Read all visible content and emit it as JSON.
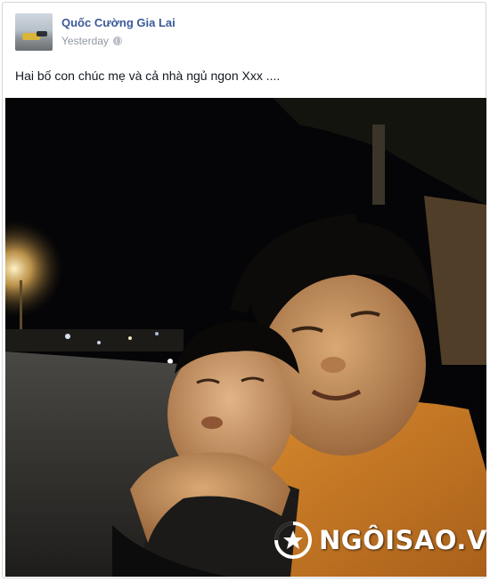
{
  "post": {
    "author": "Quốc Cường Gia Lai",
    "timestamp": "Yesterday",
    "audience_icon": "globe-icon",
    "status_text": "Hai bố con chúc mẹ và cả nhà ngủ ngon Xxx ...."
  },
  "photo": {
    "watermark": "NGÔISAO.VN",
    "watermark_logo_icon": "ngoisao-logo-icon"
  },
  "colors": {
    "author_link": "#3b5998",
    "timestamp": "#9197a3",
    "post_border": "#d3d6db"
  }
}
